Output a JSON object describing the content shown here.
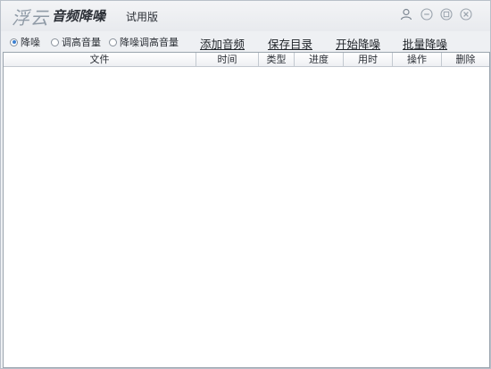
{
  "titlebar": {
    "logo_text": "浮云",
    "app_name": "音频降噪",
    "edition": "试用版",
    "icons": [
      "user-icon",
      "minimize-icon",
      "restore-icon",
      "close-icon"
    ]
  },
  "modes": [
    {
      "label": "降噪",
      "checked": true
    },
    {
      "label": "调高音量",
      "checked": false
    },
    {
      "label": "降噪调高音量",
      "checked": false
    }
  ],
  "actions": {
    "add_audio": "添加音频",
    "save_dir": "保存目录",
    "start_denoise": "开始降噪",
    "batch_denoise": "批量降噪"
  },
  "table": {
    "columns": [
      "文件",
      "时间",
      "类型",
      "进度",
      "用时",
      "操作",
      "删除"
    ],
    "rows": []
  },
  "colors": {
    "accent": "#3b7fd1",
    "window_bg": "#eef0f3",
    "table_bg": "#ffffff"
  }
}
